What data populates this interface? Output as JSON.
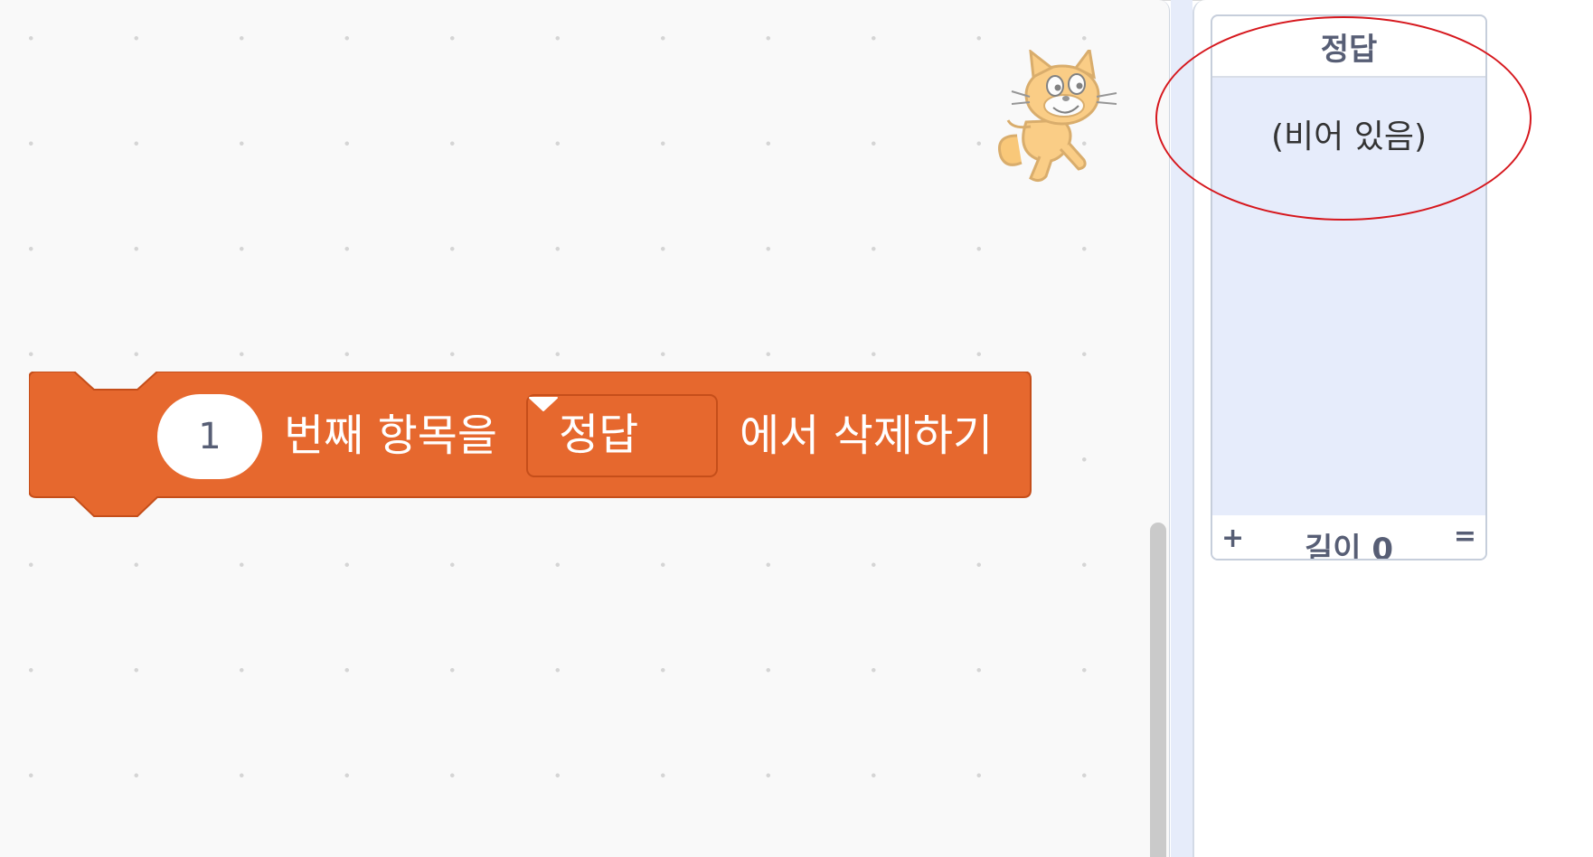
{
  "block": {
    "index_value": "1",
    "text_before": "번째 항목을",
    "dropdown_value": "정답",
    "text_after": "에서 삭제하기",
    "color": "#e6682e",
    "border_color": "#c54e1a"
  },
  "list_monitor": {
    "title": "정답",
    "empty_text": "(비어 있음)",
    "add_label": "+",
    "length_label": "길이 0",
    "resize_label": "="
  },
  "sprite": {
    "icon": "scratch-cat-sprite-icon"
  },
  "annotation": {
    "color": "#d6171d"
  }
}
